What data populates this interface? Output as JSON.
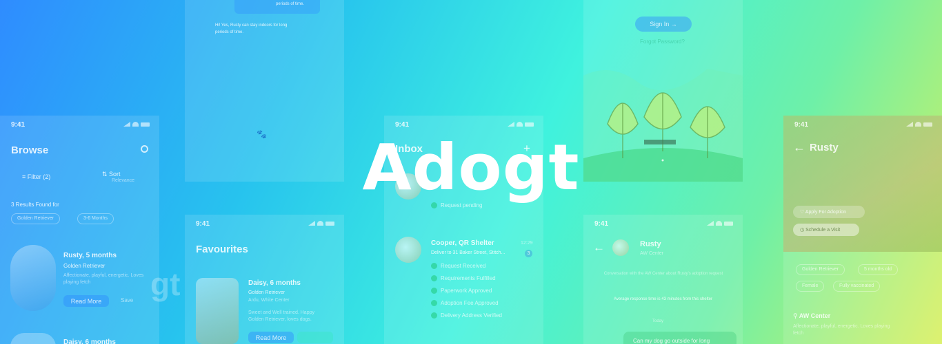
{
  "brand": {
    "logo_text": "Adogt",
    "ghost_text": "gt"
  },
  "status_time": "9:41",
  "browse": {
    "title": "Browse",
    "filter_label": "Filter (2)",
    "sort_label": "Sort",
    "sort_sub": "Relevance",
    "results_text": "3 Results Found for",
    "chips": [
      "Golden Retriever",
      "3-6 Months"
    ],
    "pet1": {
      "name": "Rusty, 5 months",
      "breed": "Golden Retriever",
      "desc": "Affectionate, playful, energetic. Loves playing fetch",
      "read_more": "Read More",
      "save": "Save"
    },
    "pet2": {
      "name": "Daisy, 6 months"
    }
  },
  "chat_top": {
    "bubble_tail": "periods of time.",
    "message": "Hi! Yes, Rusty can stay indoors for long periods of time."
  },
  "favourites": {
    "title": "Favourites",
    "pet": {
      "name": "Daisy, 6 months",
      "breed": "Golden Retriever",
      "location": "Ardu, White Center",
      "desc": "Sweet and Well trained. Happy Golden Retriever, loves dogs.",
      "read_more": "Read More"
    }
  },
  "inbox": {
    "title": "Inbox",
    "item1_status": "Request pending",
    "item2": {
      "name": "Cooper, QR Shelter",
      "time": "12:29",
      "address": "Deliver to 31 Baker Street, Stitch...",
      "badge": "3",
      "steps": [
        "Request Received",
        "Requirements Fulfilled",
        "Paperwork Approved",
        "Adoption Fee Approved",
        "Delivery Address Verified"
      ]
    }
  },
  "signin": {
    "button_label": "Sign In",
    "link_text": "Forgot Password?"
  },
  "chat_rusty": {
    "name": "Rusty",
    "sub": "AW Center",
    "intro": "Conversation with the AW Center about Rusty's adoption request",
    "response_note": "Average response time is 43 minutes from this shelter",
    "day": "Today",
    "bubble": "Can my dog go outside for long"
  },
  "rusty_detail": {
    "title": "Rusty",
    "apply_label": "Apply For Adoption",
    "visit_label": "Schedule a Visit",
    "tags": [
      "Golden Retriever",
      "5 months old",
      "Female",
      "Fully vaccinated"
    ],
    "location": "AW Center",
    "desc": "Affectionate, playful, energetic. Loves playing fetch"
  }
}
